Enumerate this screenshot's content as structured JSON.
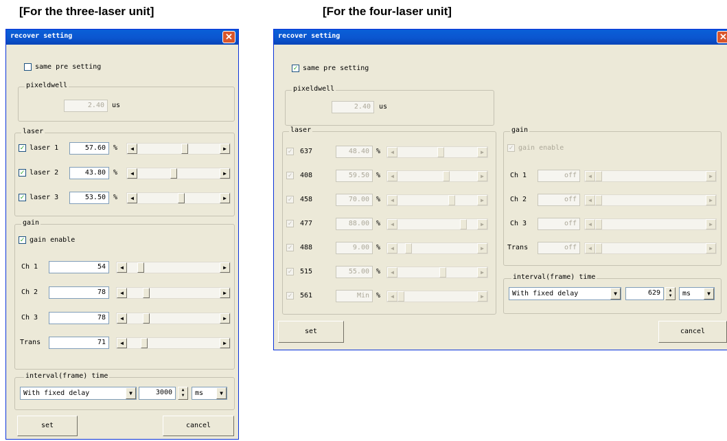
{
  "headings": {
    "three": "[For the three-laser unit]",
    "four": "[For the four-laser unit]"
  },
  "colors": {
    "title_bar": "#0b56d0",
    "window_bg": "#ece9d8",
    "close_button": "#d9562b",
    "check_mark": "#21a121"
  },
  "icons": {
    "close": "close-icon",
    "scroll_left": "arrow-left-icon",
    "scroll_right": "arrow-right-icon",
    "dropdown": "chevron-down-icon",
    "spin": "spin-up-down-icon"
  },
  "three": {
    "title": "recover setting",
    "close_glyph": "✕",
    "same_pre": {
      "label": "same pre setting",
      "checked": false,
      "mark": ""
    },
    "pixel": {
      "group_label": "pixeldwell",
      "value": "2.40",
      "unit": "us"
    },
    "laser": {
      "group_label": "laser",
      "rows": [
        {
          "label": "laser 1",
          "value": "57.60",
          "unit": "%",
          "mark": "✓",
          "level": 0.58
        },
        {
          "label": "laser 2",
          "value": "43.80",
          "unit": "%",
          "mark": "✓",
          "level": 0.44
        },
        {
          "label": "laser 3",
          "value": "53.50",
          "unit": "%",
          "mark": "✓",
          "level": 0.54
        }
      ]
    },
    "gain": {
      "group_label": "gain",
      "enable": {
        "label": "gain enable",
        "mark": "✓"
      },
      "rows": [
        {
          "label": "Ch 1",
          "value": "54",
          "level": 0.12
        },
        {
          "label": "Ch 2",
          "value": "78",
          "level": 0.18
        },
        {
          "label": "Ch 3",
          "value": "78",
          "level": 0.18
        },
        {
          "label": "Trans",
          "value": "71",
          "level": 0.16
        }
      ]
    },
    "interval": {
      "group_label": "interval(frame) time",
      "mode": "With fixed delay",
      "time": "3000",
      "unit": "ms"
    },
    "buttons": {
      "set": "set",
      "cancel": "cancel"
    }
  },
  "four": {
    "title": "recover setting",
    "close_glyph": "✕",
    "same_pre": {
      "label": "same pre setting",
      "checked": true,
      "mark": "✓"
    },
    "pixel": {
      "group_label": "pixeldwell",
      "value": "2.40",
      "unit": "us"
    },
    "laser": {
      "group_label": "laser",
      "rows": [
        {
          "label": "637",
          "value": "48.40",
          "unit": "%",
          "mark": "✓",
          "level": 0.55
        },
        {
          "label": "408",
          "value": "59.50",
          "unit": "%",
          "mark": "✓",
          "level": 0.62
        },
        {
          "label": "458",
          "value": "70.00",
          "unit": "%",
          "mark": "✓",
          "level": 0.7
        },
        {
          "label": "477",
          "value": "88.00",
          "unit": "%",
          "mark": "✓",
          "level": 0.86
        },
        {
          "label": "488",
          "value": "9.00",
          "unit": "%",
          "mark": "✓",
          "level": 0.1
        },
        {
          "label": "515",
          "value": "55.00",
          "unit": "%",
          "mark": "✓",
          "level": 0.58
        },
        {
          "label": "561",
          "value": "Min",
          "unit": "%",
          "mark": "✓",
          "level": 0.0
        }
      ]
    },
    "gain": {
      "group_label": "gain",
      "enable": {
        "label": "gain enable",
        "mark": "✓"
      },
      "rows": [
        {
          "label": "Ch 1",
          "value": "off",
          "level": 0.0
        },
        {
          "label": "Ch 2",
          "value": "off",
          "level": 0.0
        },
        {
          "label": "Ch 3",
          "value": "off",
          "level": 0.0
        },
        {
          "label": "Trans",
          "value": "off",
          "level": 0.0
        }
      ]
    },
    "interval": {
      "group_label": "interval(frame) time",
      "mode": "With fixed delay",
      "time": "629",
      "unit": "ms"
    },
    "buttons": {
      "set": "set",
      "cancel": "cancel"
    }
  }
}
